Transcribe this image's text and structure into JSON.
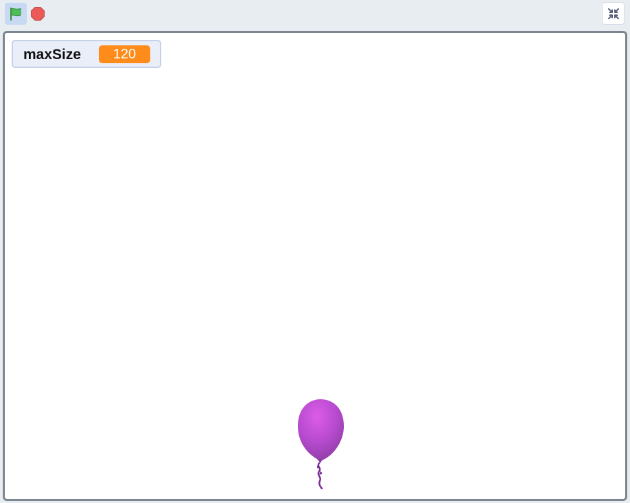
{
  "toolbar": {
    "green_flag_icon": "green-flag-icon",
    "stop_icon": "stop-icon",
    "fullscreen_icon": "exit-fullscreen-icon",
    "flag_color": "#4cbf56",
    "stop_color": "#ec5959"
  },
  "stage": {
    "variable_monitor": {
      "label": "maxSize",
      "value": "120",
      "value_color": "#ff8c1a"
    },
    "sprite": {
      "name": "balloon",
      "color": "#c24ad6"
    }
  }
}
